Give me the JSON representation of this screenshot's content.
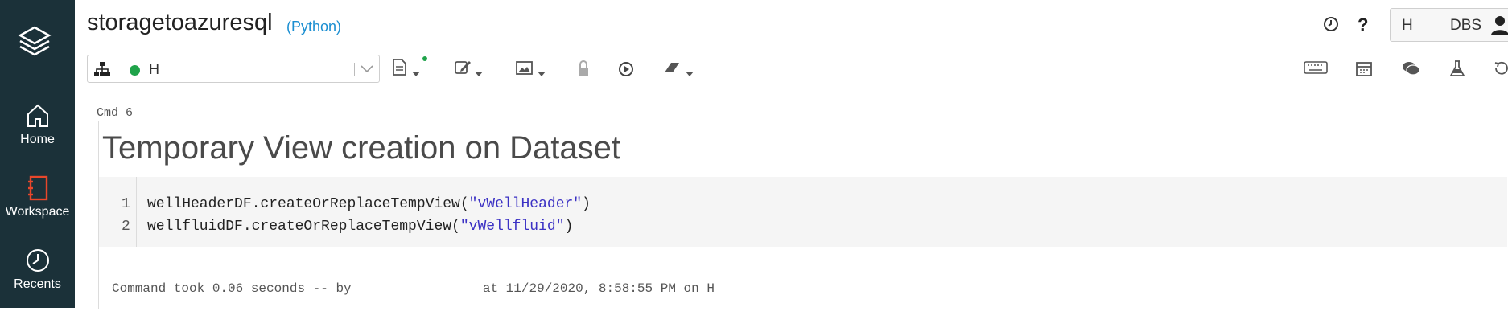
{
  "notebook": {
    "title": "storagetoazuresql",
    "language": "(Python)"
  },
  "sidebar": {
    "items": [
      {
        "label": "Home",
        "icon": "home-icon"
      },
      {
        "label": "Workspace",
        "icon": "workspace-icon"
      },
      {
        "label": "Recents",
        "icon": "clock-icon"
      }
    ]
  },
  "user": {
    "initial": "H",
    "org": "DBS"
  },
  "cluster": {
    "name": "H",
    "status_color": "#1fa34a"
  },
  "cell": {
    "cmd_label": "Cmd 6",
    "heading": "Temporary View creation on Dataset",
    "code": [
      {
        "num": "1",
        "prefix": "wellHeaderDF.createOrReplaceTempView(",
        "string": "\"vWellHeader\"",
        "suffix": ")"
      },
      {
        "num": "2",
        "prefix": "wellfluidDF.createOrReplaceTempView(",
        "string": "\"vWellfluid\"",
        "suffix": ")"
      }
    ],
    "result": "Command took 0.06 seconds -- by                 at 11/29/2020, 8:58:55 PM on H"
  },
  "colors": {
    "sidebar_bg": "#1b3139",
    "workspace_accent": "#e8472b",
    "link": "#1a8ed1"
  }
}
